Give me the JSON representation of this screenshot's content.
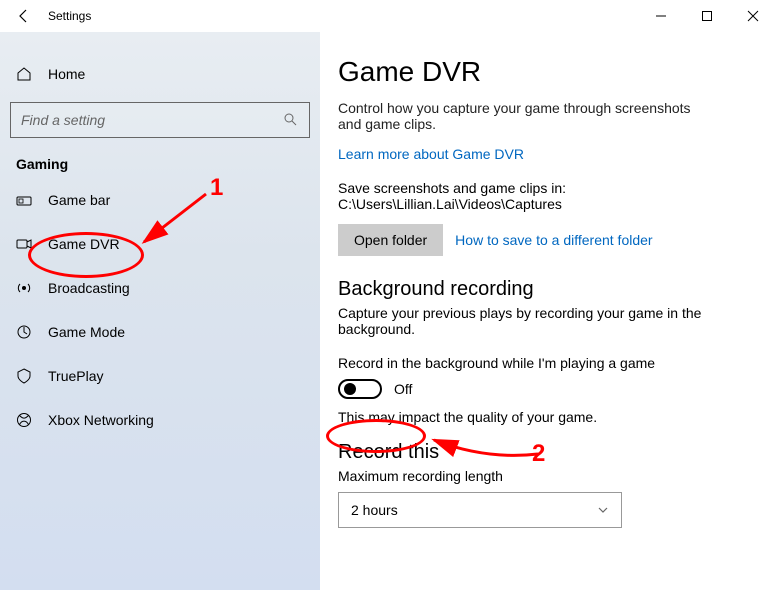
{
  "titlebar": {
    "title": "Settings"
  },
  "sidebar": {
    "home": "Home",
    "search_placeholder": "Find a setting",
    "category": "Gaming",
    "items": [
      {
        "label": "Game bar"
      },
      {
        "label": "Game DVR"
      },
      {
        "label": "Broadcasting"
      },
      {
        "label": "Game Mode"
      },
      {
        "label": "TruePlay"
      },
      {
        "label": "Xbox Networking"
      }
    ]
  },
  "main": {
    "title": "Game DVR",
    "description": "Control how you capture your game through screenshots and game clips.",
    "learn_more": "Learn more about Game DVR",
    "save_path": "Save screenshots and game clips in: C:\\Users\\Lillian.Lai\\Videos\\Captures",
    "open_folder": "Open folder",
    "save_diff": "How to save to a different folder",
    "bg_title": "Background recording",
    "bg_desc": "Capture your previous plays by recording your game in the background.",
    "record_label": "Record in the background while I'm playing a game",
    "toggle_state": "Off",
    "quality_note": "This may impact the quality of your game.",
    "record_this_title": "Record this",
    "max_length_label": "Maximum recording length",
    "max_length_value": "2 hours"
  },
  "annotations": {
    "num1": "1",
    "num2": "2"
  }
}
